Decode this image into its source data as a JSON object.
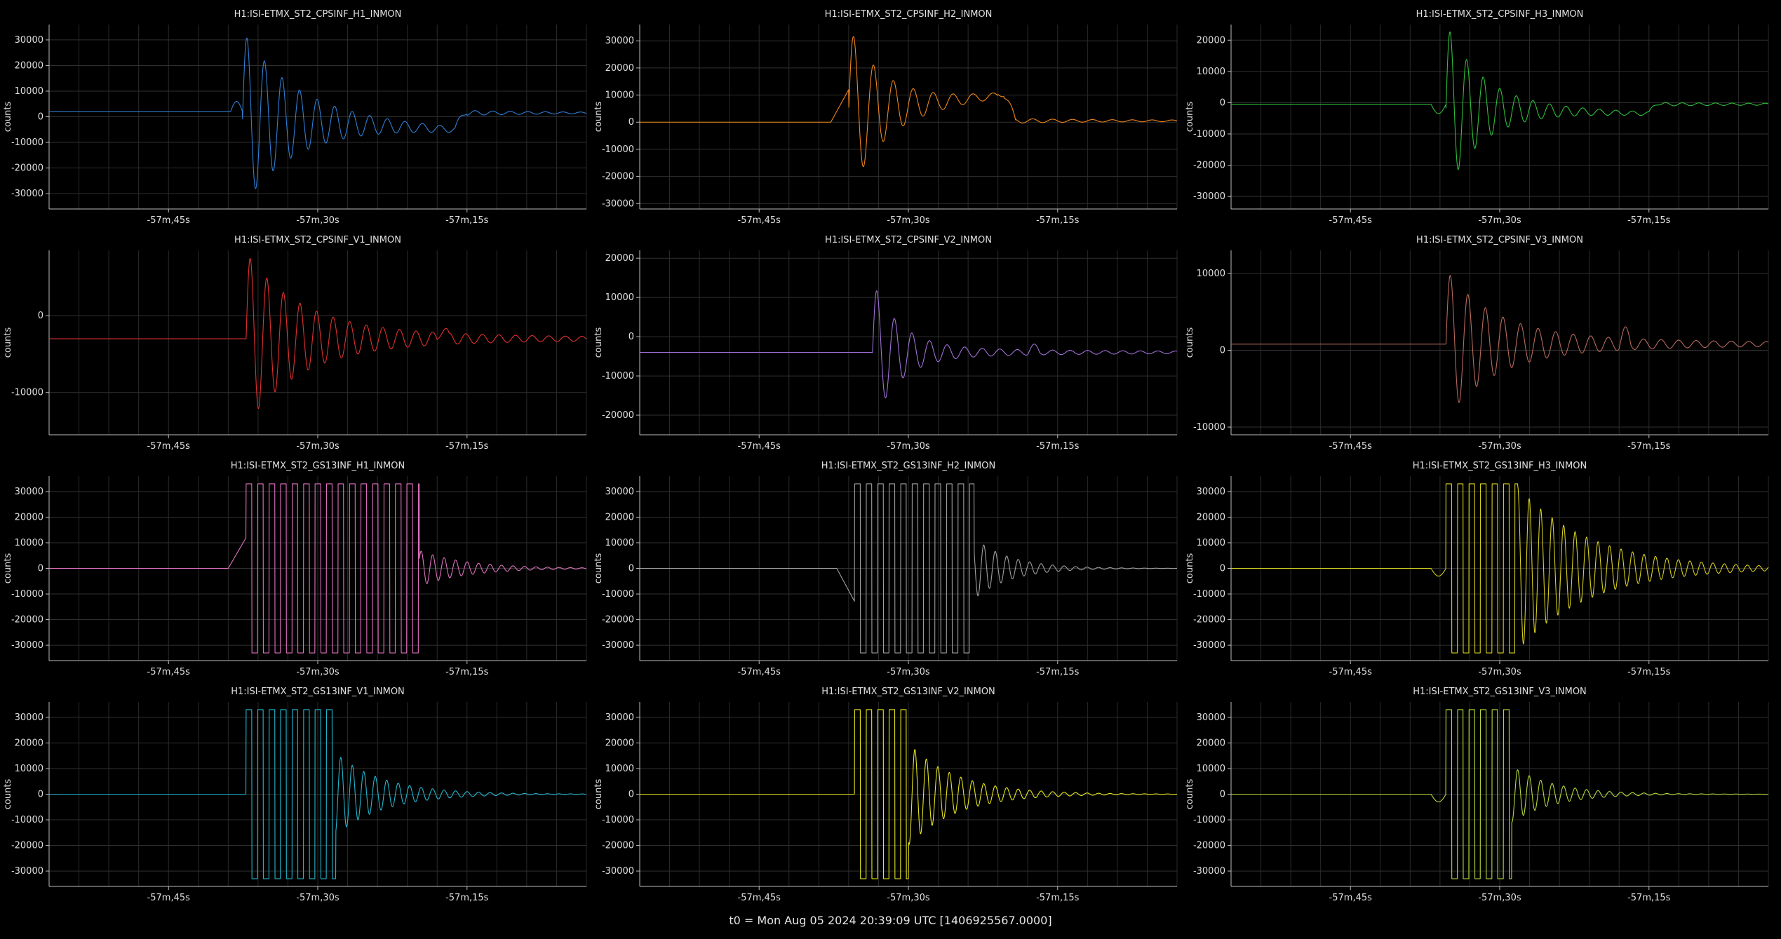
{
  "footer": "t0 = Mon Aug 05 2024 20:39:09 UTC [1406925567.0000]",
  "axis_style": {
    "bg": "#000000",
    "grid": "#2a2a2a",
    "axis": "#bdbdbd",
    "text": "#e0e0e0"
  },
  "chart_data": [
    {
      "type": "line",
      "title": "H1:ISI-ETMX_ST2_CPSINF_H1_INMON",
      "ylabel": "counts",
      "xlim": [
        -57.95,
        -57.05
      ],
      "ylim": [
        -36000,
        36000
      ],
      "yticks": [
        30000,
        20000,
        10000,
        0,
        -10000,
        -20000,
        -30000
      ],
      "yticklabels": [
        "30000",
        "20000",
        "10000",
        "0",
        "-10000",
        "-20000",
        "-30000"
      ],
      "xticks": [
        -57.75,
        -57.5,
        -57.25
      ],
      "xticklabels": [
        "-57m,45s",
        "-57m,30s",
        "-57m,15s"
      ],
      "series": [
        {
          "color": "#2f7fd6",
          "baseline": 2000,
          "after": 1500,
          "pre": "bump",
          "kind": "decay",
          "start": -57.626,
          "end": -57.27,
          "amp": 33000,
          "decayTau": 0.09,
          "cycles": 34,
          "offset": -7000,
          "offEnd": -57.27,
          "clip": 33000
        }
      ]
    },
    {
      "type": "line",
      "title": "H1:ISI-ETMX_ST2_CPSINF_H2_INMON",
      "ylabel": "counts",
      "xlim": [
        -57.95,
        -57.05
      ],
      "ylim": [
        -32000,
        36000
      ],
      "yticks": [
        30000,
        20000,
        10000,
        0,
        -10000,
        -20000,
        -30000
      ],
      "yticklabels": [
        "30000",
        "20000",
        "10000",
        "0",
        "-10000",
        "-20000",
        "-30000"
      ],
      "xticks": [
        -57.75,
        -57.5,
        -57.25
      ],
      "xticklabels": [
        "-57m,45s",
        "-57m,30s",
        "-57m,15s"
      ],
      "series": [
        {
          "color": "#f0851a",
          "baseline": 0,
          "after": 500,
          "pre": "riseup",
          "kind": "decay",
          "start": -57.6,
          "end": -57.35,
          "amp": 30000,
          "decayTau": 0.06,
          "cycles": 30,
          "offset": 10000,
          "offEnd": -57.34,
          "clip": 33000
        }
      ]
    },
    {
      "type": "line",
      "title": "H1:ISI-ETMX_ST2_CPSINF_H3_INMON",
      "ylabel": "counts",
      "xlim": [
        -57.95,
        -57.05
      ],
      "ylim": [
        -34000,
        25000
      ],
      "yticks": [
        20000,
        10000,
        0,
        -10000,
        -20000,
        -30000
      ],
      "yticklabels": [
        "20000",
        "10000",
        "0",
        "-10000",
        "-20000",
        "-30000"
      ],
      "xticks": [
        -57.75,
        -57.5,
        -57.25
      ],
      "xticklabels": [
        "-57m,45s",
        "-57m,30s",
        "-57m,15s"
      ],
      "series": [
        {
          "color": "#2fbf3a",
          "baseline": -500,
          "after": -500,
          "pre": "dip",
          "kind": "decay",
          "start": -57.59,
          "end": -57.2,
          "amp": 26000,
          "decayTau": 0.06,
          "cycles": 36,
          "offset": -3000,
          "offEnd": -57.25,
          "clip": 33000
        }
      ]
    },
    {
      "type": "line",
      "title": "H1:ISI-ETMX_ST2_CPSINF_V1_INMON",
      "ylabel": "counts",
      "xlim": [
        -57.95,
        -57.05
      ],
      "ylim": [
        -15500,
        8500
      ],
      "yticks": [
        0,
        -10000
      ],
      "yticklabels": [
        "0",
        "-10000"
      ],
      "xticks": [
        -57.75,
        -57.5,
        -57.25
      ],
      "xticklabels": [
        "-57m,45s",
        "-57m,30s",
        "-57m,15s"
      ],
      "series": [
        {
          "color": "#e03030",
          "baseline": -3000,
          "after": -3000,
          "pre": "none",
          "kind": "decay",
          "start": -57.62,
          "end": -57.22,
          "amp": 10000,
          "decayTau": 0.09,
          "cycles": 36,
          "offset": 0,
          "offEnd": -57.3,
          "clip": 33000
        }
      ]
    },
    {
      "type": "line",
      "title": "H1:ISI-ETMX_ST2_CPSINF_V2_INMON",
      "ylabel": "counts",
      "xlim": [
        -57.95,
        -57.05
      ],
      "ylim": [
        -25000,
        22000
      ],
      "yticks": [
        20000,
        10000,
        0,
        -10000,
        -20000
      ],
      "yticklabels": [
        "20000",
        "10000",
        "0",
        "-10000",
        "-20000"
      ],
      "xticks": [
        -57.75,
        -57.5,
        -57.25
      ],
      "xticklabels": [
        "-57m,45s",
        "-57m,30s",
        "-57m,15s"
      ],
      "series": [
        {
          "color": "#a070d8",
          "baseline": -4000,
          "after": -4000,
          "pre": "none",
          "kind": "decay",
          "start": -57.56,
          "end": -57.25,
          "amp": 17000,
          "decayTau": 0.045,
          "cycles": 34,
          "offset": 0,
          "offEnd": -57.3,
          "clip": 33000
        }
      ]
    },
    {
      "type": "line",
      "title": "H1:ISI-ETMX_ST2_CPSINF_V3_INMON",
      "ylabel": "counts",
      "xlim": [
        -57.95,
        -57.05
      ],
      "ylim": [
        -11000,
        13000
      ],
      "yticks": [
        10000,
        0,
        -10000
      ],
      "yticklabels": [
        "10000",
        "0",
        "-10000"
      ],
      "xticks": [
        -57.75,
        -57.5,
        -57.25
      ],
      "xticklabels": [
        "-57m,45s",
        "-57m,30s",
        "-57m,15s"
      ],
      "series": [
        {
          "color": "#b86a5c",
          "baseline": 800,
          "after": 800,
          "pre": "none",
          "kind": "decay",
          "start": -57.59,
          "end": -57.22,
          "amp": 8500,
          "decayTau": 0.08,
          "cycles": 34,
          "offset": 0,
          "offEnd": -57.3,
          "clip": 33000
        }
      ]
    },
    {
      "type": "line",
      "title": "H1:ISI-ETMX_ST2_GS13INF_H1_INMON",
      "ylabel": "counts",
      "xlim": [
        -57.95,
        -57.05
      ],
      "ylim": [
        -36000,
        36000
      ],
      "yticks": [
        30000,
        20000,
        10000,
        0,
        -10000,
        -20000,
        -30000
      ],
      "yticklabels": [
        "30000",
        "20000",
        "10000",
        "0",
        "-10000",
        "-20000",
        "-30000"
      ],
      "xticks": [
        -57.75,
        -57.5,
        -57.25
      ],
      "xticklabels": [
        "-57m,45s",
        "-57m,30s",
        "-57m,15s"
      ],
      "series": [
        {
          "color": "#e072c0",
          "baseline": 0,
          "after": 0,
          "pre": "riseup",
          "kind": "sat",
          "start": -57.62,
          "satEnd": -57.33,
          "end": -57.06,
          "amp": 33000,
          "ringAmp": 7000,
          "decayTau": 0.08,
          "cycles": 52,
          "clip": 33000
        }
      ]
    },
    {
      "type": "line",
      "title": "H1:ISI-ETMX_ST2_GS13INF_H2_INMON",
      "ylabel": "counts",
      "xlim": [
        -57.95,
        -57.05
      ],
      "ylim": [
        -36000,
        36000
      ],
      "yticks": [
        30000,
        20000,
        10000,
        0,
        -10000,
        -20000,
        -30000
      ],
      "yticklabels": [
        "30000",
        "20000",
        "10000",
        "0",
        "-10000",
        "-20000",
        "-30000"
      ],
      "xticks": [
        -57.75,
        -57.5,
        -57.25
      ],
      "xticklabels": [
        "-57m,45s",
        "-57m,30s",
        "-57m,15s"
      ],
      "series": [
        {
          "color": "#a0a0a0",
          "baseline": 0,
          "after": 0,
          "pre": "dipdown",
          "kind": "sat",
          "start": -57.59,
          "satEnd": -57.39,
          "end": -57.06,
          "amp": 33000,
          "ringAmp": 12000,
          "decayTau": 0.06,
          "cycles": 52,
          "clip": 33000
        }
      ]
    },
    {
      "type": "line",
      "title": "H1:ISI-ETMX_ST2_GS13INF_H3_INMON",
      "ylabel": "counts",
      "xlim": [
        -57.95,
        -57.05
      ],
      "ylim": [
        -36000,
        36000
      ],
      "yticks": [
        30000,
        20000,
        10000,
        0,
        -10000,
        -20000,
        -30000
      ],
      "yticklabels": [
        "30000",
        "20000",
        "10000",
        "0",
        "-10000",
        "-20000",
        "-30000"
      ],
      "xticks": [
        -57.75,
        -57.5,
        -57.25
      ],
      "xticklabels": [
        "-57m,45s",
        "-57m,30s",
        "-57m,15s"
      ],
      "series": [
        {
          "color": "#d6d020",
          "baseline": 0,
          "after": 0,
          "pre": "dip",
          "kind": "sat",
          "start": -57.59,
          "satEnd": -57.47,
          "end": -57.06,
          "amp": 33000,
          "ringAmp": 32000,
          "decayTau": 0.12,
          "cycles": 52,
          "clip": 33000
        }
      ]
    },
    {
      "type": "line",
      "title": "H1:ISI-ETMX_ST2_GS13INF_V1_INMON",
      "ylabel": "counts",
      "xlim": [
        -57.95,
        -57.05
      ],
      "ylim": [
        -36000,
        36000
      ],
      "yticks": [
        30000,
        20000,
        10000,
        0,
        -10000,
        -20000,
        -30000
      ],
      "yticklabels": [
        "30000",
        "20000",
        "10000",
        "0",
        "-10000",
        "-20000",
        "-30000"
      ],
      "xticks": [
        -57.75,
        -57.5,
        -57.25
      ],
      "xticklabels": [
        "-57m,45s",
        "-57m,30s",
        "-57m,15s"
      ],
      "series": [
        {
          "color": "#22b8cf",
          "baseline": 0,
          "after": 0,
          "pre": "none",
          "kind": "sat",
          "start": -57.62,
          "satEnd": -57.47,
          "end": -57.06,
          "amp": 33000,
          "ringAmp": 16000,
          "decayTau": 0.08,
          "cycles": 52,
          "clip": 33000
        }
      ]
    },
    {
      "type": "line",
      "title": "H1:ISI-ETMX_ST2_GS13INF_V2_INMON",
      "ylabel": "counts",
      "xlim": [
        -57.95,
        -57.05
      ],
      "ylim": [
        -36000,
        36000
      ],
      "yticks": [
        30000,
        20000,
        10000,
        0,
        -10000,
        -20000,
        -30000
      ],
      "yticklabels": [
        "30000",
        "20000",
        "10000",
        "0",
        "-10000",
        "-20000",
        "-30000"
      ],
      "xticks": [
        -57.75,
        -57.5,
        -57.25
      ],
      "xticklabels": [
        "-57m,45s",
        "-57m,30s",
        "-57m,15s"
      ],
      "series": [
        {
          "color": "#e8e81e",
          "baseline": 0,
          "after": 0,
          "pre": "none",
          "kind": "sat",
          "start": -57.59,
          "satEnd": -57.5,
          "end": -57.06,
          "amp": 33000,
          "ringAmp": 20000,
          "decayTau": 0.08,
          "cycles": 52,
          "clip": 33000
        }
      ]
    },
    {
      "type": "line",
      "title": "H1:ISI-ETMX_ST2_GS13INF_V3_INMON",
      "ylabel": "counts",
      "xlim": [
        -57.95,
        -57.05
      ],
      "ylim": [
        -36000,
        36000
      ],
      "yticks": [
        30000,
        20000,
        10000,
        0,
        -10000,
        -20000,
        -30000
      ],
      "yticklabels": [
        "30000",
        "20000",
        "10000",
        "0",
        "-10000",
        "-20000",
        "-30000"
      ],
      "xticks": [
        -57.75,
        -57.5,
        -57.25
      ],
      "xticklabels": [
        "-57m,45s",
        "-57m,30s",
        "-57m,15s"
      ],
      "series": [
        {
          "color": "#b4dc3c",
          "baseline": 0,
          "after": 0,
          "pre": "dip",
          "kind": "sat",
          "start": -57.59,
          "satEnd": -57.48,
          "end": -57.06,
          "amp": 33000,
          "ringAmp": 11000,
          "decayTau": 0.07,
          "cycles": 52,
          "clip": 33000
        }
      ]
    }
  ]
}
